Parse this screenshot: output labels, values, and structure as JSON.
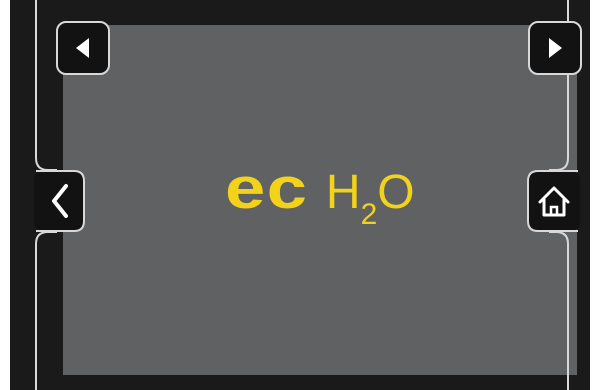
{
  "brand": {
    "logo_ec": "ec",
    "logo_h": "H",
    "logo_sub": "2",
    "logo_o": "O",
    "color": "#f2d21a"
  },
  "nav": {
    "prev_icon": "arrow-left-icon",
    "next_icon": "arrow-right-icon",
    "back_icon": "chevron-left-icon",
    "home_icon": "home-icon"
  },
  "colors": {
    "screen_bg": "#5f6163",
    "frame_bg": "#1a1a1a",
    "outline": "#d8d8d8"
  }
}
